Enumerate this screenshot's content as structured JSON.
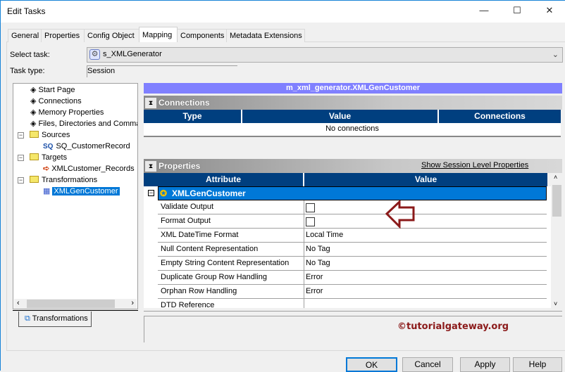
{
  "window": {
    "title": "Edit Tasks",
    "minimize": "—",
    "maximize": "☐",
    "close": "✕"
  },
  "tabs": [
    {
      "label": "General"
    },
    {
      "label": "Properties"
    },
    {
      "label": "Config Object"
    },
    {
      "label": "Mapping",
      "selected": true
    },
    {
      "label": "Components"
    },
    {
      "label": "Metadata Extensions"
    }
  ],
  "form": {
    "select_task_label": "Select task:",
    "select_task_value": "s_XMLGenerator",
    "task_type_label": "Task type:",
    "task_type_value": "Session"
  },
  "tree": {
    "items": [
      {
        "label": "Start Page",
        "icon": "page-icon"
      },
      {
        "label": "Connections",
        "icon": "page-icon"
      },
      {
        "label": "Memory Properties",
        "icon": "page-icon"
      },
      {
        "label": "Files, Directories and Commands",
        "icon": "page-icon"
      },
      {
        "label": "Sources",
        "icon": "folder-icon",
        "expanded": true
      },
      {
        "label": "SQ_CustomerRecord",
        "icon": "source-qualifier-icon",
        "badge": "SQ"
      },
      {
        "label": "Targets",
        "icon": "folder-icon",
        "expanded": true
      },
      {
        "label": "XMLCustomer_Records",
        "icon": "target-icon"
      },
      {
        "label": "Transformations",
        "icon": "folder-icon",
        "expanded": true
      },
      {
        "label": "XMLGenCustomer",
        "icon": "xml-generator-icon",
        "selected": true
      }
    ],
    "bottom_tab": "Transformations"
  },
  "mapping_header": "m_xml_generator.XMLGenCustomer",
  "connections": {
    "title": "Connections",
    "columns": [
      "Type",
      "Value",
      "Connections"
    ],
    "empty_text": "No connections"
  },
  "properties": {
    "title": "Properties",
    "link": "Show Session Level Properties",
    "columns": [
      "Attribute",
      "Value"
    ],
    "group": "XMLGenCustomer",
    "rows": [
      {
        "attribute": "Validate Output",
        "value": "",
        "checkbox": true,
        "checked": false
      },
      {
        "attribute": "Format Output",
        "value": "",
        "checkbox": true,
        "checked": false
      },
      {
        "attribute": "XML DateTime Format",
        "value": "Local Time"
      },
      {
        "attribute": "Null Content Representation",
        "value": "No Tag"
      },
      {
        "attribute": "Empty String Content Representation",
        "value": "No Tag"
      },
      {
        "attribute": "Duplicate Group Row Handling",
        "value": "Error"
      },
      {
        "attribute": "Orphan Row Handling",
        "value": "Error"
      },
      {
        "attribute": "DTD Reference",
        "value": ""
      }
    ]
  },
  "watermark": "©tutorialgateway.org",
  "buttons": {
    "ok": "OK",
    "cancel": "Cancel",
    "apply": "Apply",
    "help": "Help"
  },
  "colors": {
    "header_blue": "#003f7f",
    "selection_blue": "#0078d7",
    "mapping_header": "#8080ff",
    "arrow": "#8b1a1a"
  }
}
